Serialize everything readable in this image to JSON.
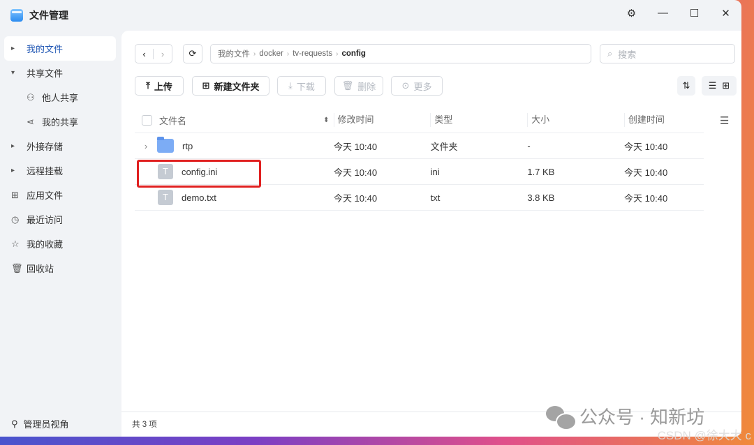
{
  "app": {
    "title": "文件管理"
  },
  "sidebar": {
    "items": [
      {
        "label": "我的文件"
      },
      {
        "label": "共享文件"
      },
      {
        "label": "他人共享"
      },
      {
        "label": "我的共享"
      },
      {
        "label": "外接存储"
      },
      {
        "label": "远程挂载"
      },
      {
        "label": "应用文件"
      },
      {
        "label": "最近访问"
      },
      {
        "label": "我的收藏"
      },
      {
        "label": "回收站"
      }
    ],
    "admin": "管理员视角"
  },
  "breadcrumb": [
    "我的文件",
    "docker",
    "tv-requests",
    "config"
  ],
  "search": {
    "placeholder": "搜索"
  },
  "toolbar": {
    "upload": "上传",
    "new_folder": "新建文件夹",
    "download": "下载",
    "delete": "删除",
    "more": "更多"
  },
  "table": {
    "headers": [
      "文件名",
      "修改时间",
      "类型",
      "大小",
      "创建时间"
    ],
    "rows": [
      {
        "name": "rtp",
        "modified": "今天 10:40",
        "type": "文件夹",
        "size": "-",
        "created": "今天 10:40"
      },
      {
        "name": "config.ini",
        "modified": "今天 10:40",
        "type": "ini",
        "size": "1.7 KB",
        "created": "今天 10:40"
      },
      {
        "name": "demo.txt",
        "modified": "今天 10:40",
        "type": "txt",
        "size": "3.8 KB",
        "created": "今天 10:40"
      }
    ]
  },
  "status": {
    "count": "共 3 项"
  },
  "watermark": {
    "wechat": "公众号 · 知新坊",
    "csdn": "CSDN @徐大大 c"
  }
}
